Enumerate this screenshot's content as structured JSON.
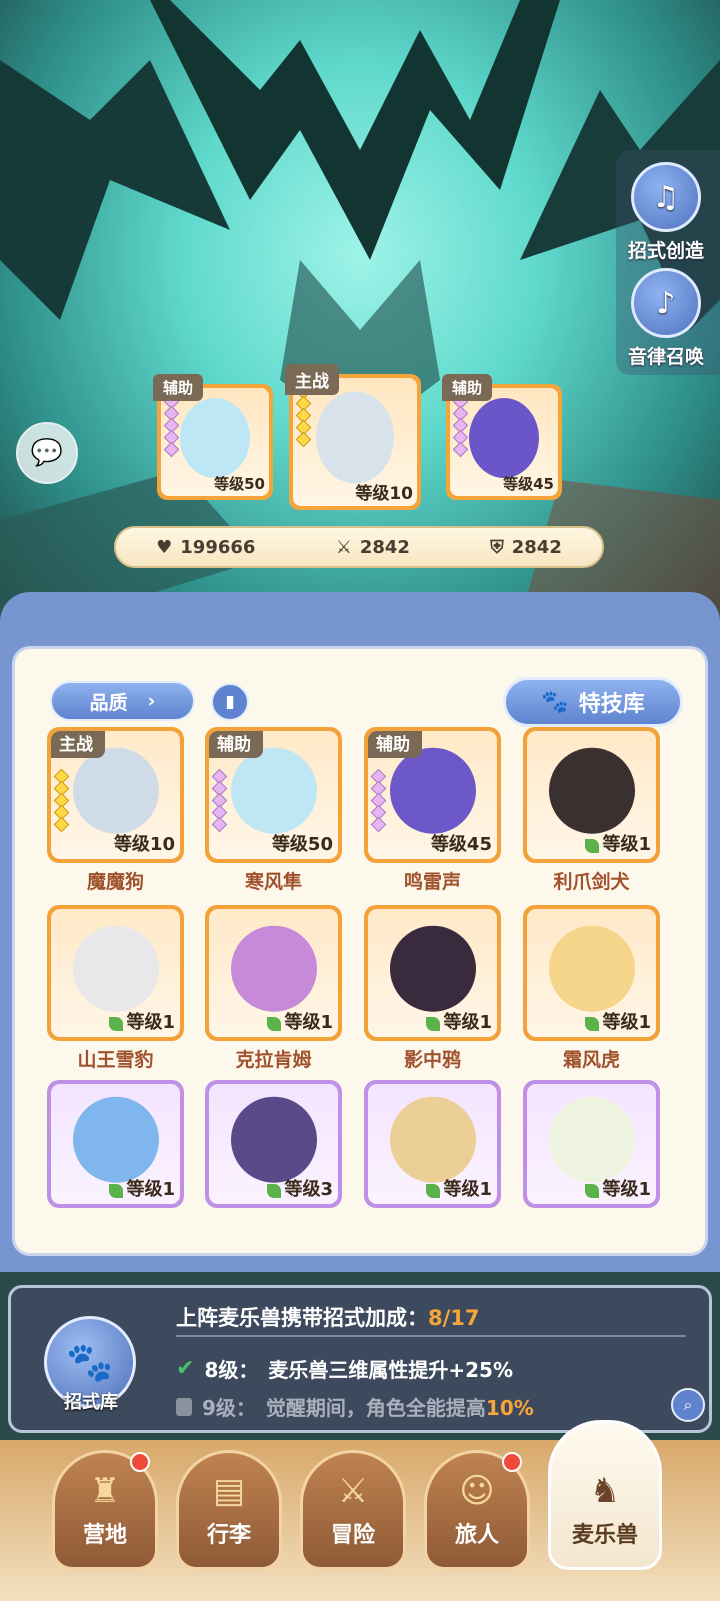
{
  "side_buttons": [
    {
      "label": "招式创造",
      "icon": "music-book-icon"
    },
    {
      "label": "音律召唤",
      "icon": "lyre-icon"
    }
  ],
  "team": [
    {
      "tag": "辅助",
      "level": "等级50",
      "stars": "purple",
      "color": "#bde7f4"
    },
    {
      "tag": "主战",
      "level": "等级10",
      "stars": "gold",
      "color": "#d8e2ea"
    },
    {
      "tag": "辅助",
      "level": "等级45",
      "stars": "purple",
      "color": "#6a56c8"
    }
  ],
  "stats": {
    "hp": "199666",
    "attack": "2842",
    "defense": "2842"
  },
  "filter": {
    "quality_label": "品质",
    "book_icon": "book-icon",
    "skill_library_label": "特技库"
  },
  "grid": [
    {
      "tag": "主战",
      "level": "等级10",
      "name": "魔魔狗",
      "rarity": "orange",
      "color": "#cfdbe6"
    },
    {
      "tag": "辅助",
      "level": "等级50",
      "name": "寒风隼",
      "rarity": "orange",
      "color": "#bfe6f3"
    },
    {
      "tag": "辅助",
      "level": "等级45",
      "name": "鸣雷声",
      "rarity": "orange",
      "color": "#6c58c8"
    },
    {
      "tag": "",
      "level": "等级1",
      "name": "利爪剑犬",
      "rarity": "orange",
      "color": "#3a3030"
    },
    {
      "tag": "",
      "level": "等级1",
      "name": "山王雪豹",
      "rarity": "orange",
      "color": "#e8e8ea"
    },
    {
      "tag": "",
      "level": "等级1",
      "name": "克拉肯姆",
      "rarity": "orange",
      "color": "#c68ad8"
    },
    {
      "tag": "",
      "level": "等级1",
      "name": "影中鸦",
      "rarity": "orange",
      "color": "#3a2a3e"
    },
    {
      "tag": "",
      "level": "等级1",
      "name": "霜风虎",
      "rarity": "orange",
      "color": "#f5d58a"
    },
    {
      "tag": "",
      "level": "等级1",
      "name": "",
      "rarity": "purple",
      "color": "#7fb6ee"
    },
    {
      "tag": "",
      "level": "等级3",
      "name": "",
      "rarity": "purple",
      "color": "#5a4a8a"
    },
    {
      "tag": "",
      "level": "等级1",
      "name": "",
      "rarity": "purple",
      "color": "#eccf96"
    },
    {
      "tag": "",
      "level": "等级1",
      "name": "",
      "rarity": "purple",
      "color": "#eef3e0"
    }
  ],
  "bonus": {
    "library_label": "招式库",
    "title": "上阵麦乐兽携带招式加成：",
    "progress": "8/17",
    "row1_level": "8级：",
    "row1_text": "麦乐兽三维属性提升+25%",
    "row2_level": "9级：",
    "row2_text": "觉醒期间，角色全能提高",
    "row2_value": "10%"
  },
  "nav": [
    {
      "label": "营地",
      "icon": "castle-icon",
      "badge": true
    },
    {
      "label": "行李",
      "icon": "chest-icon",
      "badge": false
    },
    {
      "label": "冒险",
      "icon": "swords-icon",
      "badge": false
    },
    {
      "label": "旅人",
      "icon": "traveler-icon",
      "badge": true
    },
    {
      "label": "麦乐兽",
      "icon": "pet-icon",
      "badge": false,
      "active": true
    }
  ]
}
